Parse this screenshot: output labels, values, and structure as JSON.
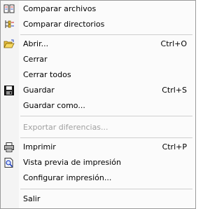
{
  "menu": {
    "items": {
      "compare_files": {
        "label": "Comparar archivos",
        "icon": "compare-files-icon"
      },
      "compare_dirs": {
        "label": "Comparar directorios",
        "icon": "compare-directories-icon"
      },
      "open": {
        "label": "Abrir...",
        "shortcut": "Ctrl+O",
        "icon": "open-folder-icon"
      },
      "close": {
        "label": "Cerrar"
      },
      "close_all": {
        "label": "Cerrar todos"
      },
      "save": {
        "label": "Guardar",
        "shortcut": "Ctrl+S",
        "icon": "floppy-disk-icon"
      },
      "save_as": {
        "label": "Guardar como..."
      },
      "export_diff": {
        "label": "Exportar diferencias...",
        "disabled": true
      },
      "print": {
        "label": "Imprimir",
        "shortcut": "Ctrl+P",
        "icon": "printer-icon"
      },
      "print_preview": {
        "label": "Vista previa de impresión",
        "icon": "print-preview-icon"
      },
      "print_setup": {
        "label": "Configurar impresión..."
      },
      "exit": {
        "label": "Salir"
      }
    }
  }
}
